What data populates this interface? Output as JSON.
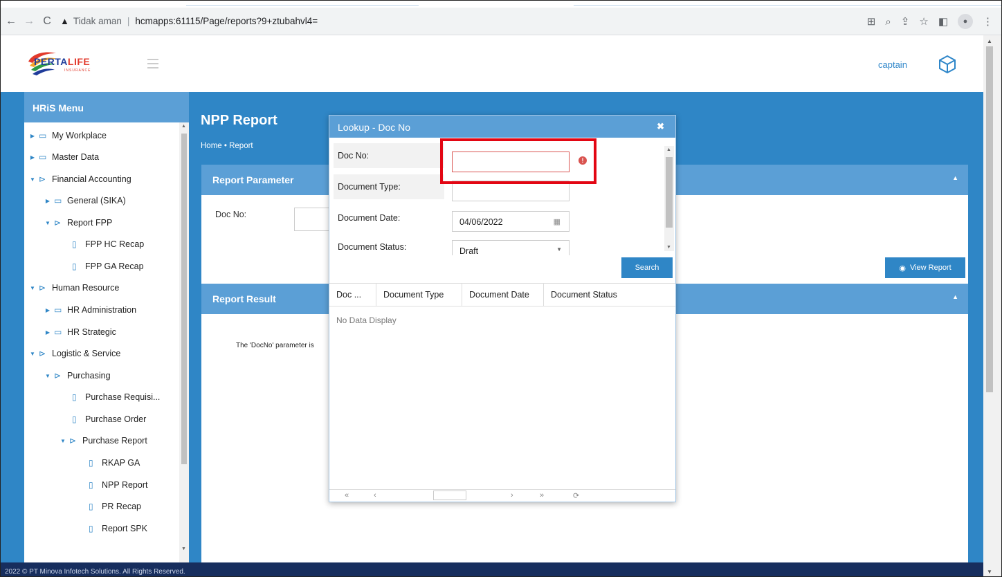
{
  "browser": {
    "security_label": "Tidak aman",
    "url": "hcmapps:61115/Page/reports?9+ztubahvl4="
  },
  "header": {
    "logo_main": "PERTA",
    "logo_accent": "LIFE",
    "logo_sub": "INSURANCE",
    "user": "captain"
  },
  "sidebar": {
    "title": "HRiS Menu",
    "items": [
      {
        "label": "My Workplace",
        "type": "folder",
        "state": "collapsed"
      },
      {
        "label": "Master Data",
        "type": "folder",
        "state": "collapsed"
      },
      {
        "label": "Financial Accounting",
        "type": "folder",
        "state": "expanded"
      },
      {
        "label": "General (SIKA)",
        "type": "folder",
        "state": "collapsed"
      },
      {
        "label": "Report FPP",
        "type": "folder",
        "state": "expanded"
      },
      {
        "label": "FPP HC Recap",
        "type": "file"
      },
      {
        "label": "FPP GA Recap",
        "type": "file"
      },
      {
        "label": "Human Resource",
        "type": "folder",
        "state": "expanded"
      },
      {
        "label": "HR Administration",
        "type": "folder",
        "state": "collapsed"
      },
      {
        "label": "HR Strategic",
        "type": "folder",
        "state": "collapsed"
      },
      {
        "label": "Logistic & Service",
        "type": "folder",
        "state": "expanded"
      },
      {
        "label": "Purchasing",
        "type": "folder",
        "state": "expanded"
      },
      {
        "label": "Purchase Requisi...",
        "type": "file"
      },
      {
        "label": "Purchase Order",
        "type": "file"
      },
      {
        "label": "Purchase Report",
        "type": "folder",
        "state": "expanded"
      },
      {
        "label": "RKAP GA",
        "type": "file"
      },
      {
        "label": "NPP Report",
        "type": "file"
      },
      {
        "label": "PR Recap",
        "type": "file"
      },
      {
        "label": "Report SPK",
        "type": "file"
      }
    ]
  },
  "page": {
    "title": "NPP Report",
    "breadcrumb_home": "Home",
    "breadcrumb_current": "Report"
  },
  "report_parameter": {
    "title": "Report Parameter",
    "doc_no_label": "Doc No:",
    "view_button": "View Report"
  },
  "report_result": {
    "title": "Report Result",
    "message": "The 'DocNo' parameter is"
  },
  "modal": {
    "title": "Lookup - Doc No",
    "fields": {
      "doc_no_label": "Doc No:",
      "doc_no_value": "",
      "doc_type_label": "Document Type:",
      "doc_type_value": "",
      "doc_date_label": "Document Date:",
      "doc_date_value": "04/06/2022",
      "doc_status_label": "Document Status:",
      "doc_status_value": "Draft"
    },
    "search_button": "Search",
    "columns": [
      "Doc ...",
      "Document Type",
      "Document Date",
      "Document Status"
    ],
    "empty_text": "No Data Display"
  },
  "footer": {
    "text": "2022 © PT Minova Infotech Solutions. All Rights Reserved."
  },
  "colors": {
    "primary": "#2f86c6",
    "panel_header": "#5b9fd6",
    "footer": "#172e5e",
    "highlight": "#e30613",
    "error": "#d9534f"
  }
}
